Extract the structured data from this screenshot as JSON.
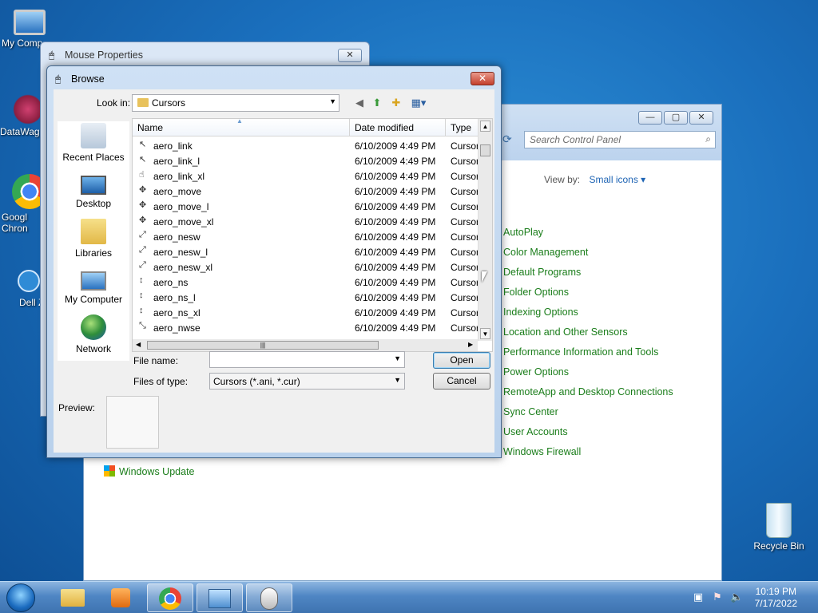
{
  "desktop": {
    "icons": [
      {
        "label": "My Comp"
      },
      {
        "label": "DataWag"
      },
      {
        "label": "Googl Chron"
      },
      {
        "label": "Dell Z"
      },
      {
        "label": "Recycle Bin"
      }
    ]
  },
  "control_panel": {
    "search_placeholder": "Search Control Panel",
    "view_by_label": "View by:",
    "view_by_value": "Small icons ▾",
    "items": [
      "AutoPlay",
      "Color Management",
      "Default Programs",
      "Folder Options",
      "Indexing Options",
      "Location and Other Sensors",
      "Performance Information and Tools",
      "Power Options",
      "RemoteApp and Desktop Connections",
      "Sync Center",
      "User Accounts",
      "Windows Firewall"
    ],
    "windows_update": "Windows Update"
  },
  "mouse_properties": {
    "title": "Mouse Properties",
    "close": "✕"
  },
  "browse": {
    "title": "Browse",
    "close": "✕",
    "look_in_label": "Look in:",
    "look_in_value": "Cursors",
    "places": [
      "Recent Places",
      "Desktop",
      "Libraries",
      "My Computer",
      "Network"
    ],
    "columns": {
      "name": "Name",
      "date": "Date modified",
      "type": "Type"
    },
    "files": [
      {
        "name": "aero_link",
        "date": "6/10/2009 4:49 PM",
        "type": "Cursor"
      },
      {
        "name": "aero_link_l",
        "date": "6/10/2009 4:49 PM",
        "type": "Cursor"
      },
      {
        "name": "aero_link_xl",
        "date": "6/10/2009 4:49 PM",
        "type": "Cursor"
      },
      {
        "name": "aero_move",
        "date": "6/10/2009 4:49 PM",
        "type": "Cursor"
      },
      {
        "name": "aero_move_l",
        "date": "6/10/2009 4:49 PM",
        "type": "Cursor"
      },
      {
        "name": "aero_move_xl",
        "date": "6/10/2009 4:49 PM",
        "type": "Cursor"
      },
      {
        "name": "aero_nesw",
        "date": "6/10/2009 4:49 PM",
        "type": "Cursor"
      },
      {
        "name": "aero_nesw_l",
        "date": "6/10/2009 4:49 PM",
        "type": "Cursor"
      },
      {
        "name": "aero_nesw_xl",
        "date": "6/10/2009 4:49 PM",
        "type": "Cursor"
      },
      {
        "name": "aero_ns",
        "date": "6/10/2009 4:49 PM",
        "type": "Cursor"
      },
      {
        "name": "aero_ns_l",
        "date": "6/10/2009 4:49 PM",
        "type": "Cursor"
      },
      {
        "name": "aero_ns_xl",
        "date": "6/10/2009 4:49 PM",
        "type": "Cursor"
      },
      {
        "name": "aero_nwse",
        "date": "6/10/2009 4:49 PM",
        "type": "Cursor"
      }
    ],
    "file_name_label": "File name:",
    "file_name_value": "",
    "files_of_type_label": "Files of type:",
    "files_of_type_value": "Cursors (*.ani, *.cur)",
    "open_label": "Open",
    "cancel_label": "Cancel",
    "preview_label": "Preview:"
  },
  "taskbar": {
    "time": "10:19 PM",
    "date": "7/17/2022"
  }
}
